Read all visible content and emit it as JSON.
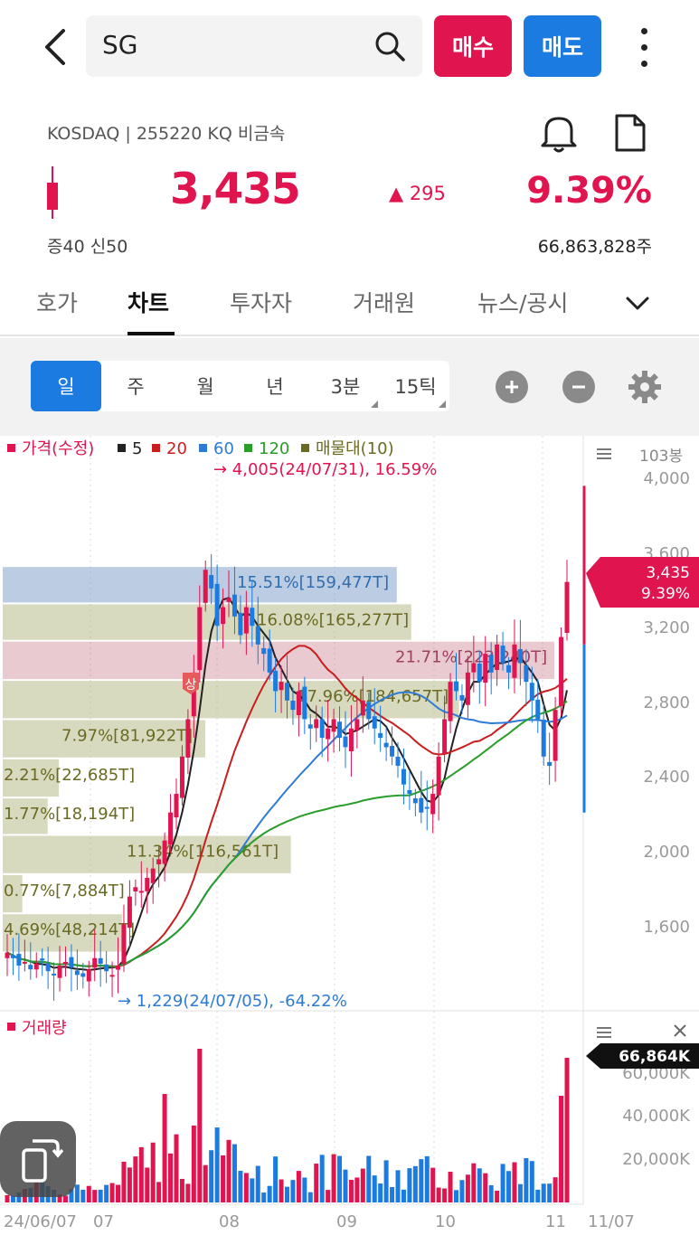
{
  "header": {
    "search_query": "SG",
    "buy_label": "매수",
    "sell_label": "매도"
  },
  "stock": {
    "market_info": "KOSDAQ | 255220 KQ 비금속",
    "price": "3,435",
    "change": "▲ 295",
    "change_pct": "9.39%",
    "margin_info": "증40  신50",
    "volume": "66,863,828주"
  },
  "tabs": [
    {
      "label": "호가"
    },
    {
      "label": "차트"
    },
    {
      "label": "투자자"
    },
    {
      "label": "거래원"
    },
    {
      "label": "뉴스/공시"
    }
  ],
  "periods": [
    {
      "label": "일"
    },
    {
      "label": "주"
    },
    {
      "label": "월"
    },
    {
      "label": "년"
    },
    {
      "label": "3분"
    },
    {
      "label": "15틱"
    }
  ],
  "colors": {
    "up": "#e0144e",
    "down": "#1b7be0",
    "ma5": "#222222",
    "ma20": "#c81e1e",
    "ma60": "#2e7bd6",
    "ma120": "#2a9d2a",
    "profile": "#9aa05a"
  },
  "legend": {
    "price": "가격(수정)",
    "ma5": "5",
    "ma20": "20",
    "ma60": "60",
    "ma120": "120",
    "profile": "매물대(10)"
  },
  "chart_data": [
    {
      "type": "candlestick",
      "unit_label": "103봉",
      "ylim": [
        1229,
        4005
      ],
      "y_ticks": [
        "4,000",
        "3,600",
        "3,200",
        "2,800",
        "2,400",
        "2,000",
        "1,600"
      ],
      "x_ticks": [
        "24/06/07",
        "07",
        "08",
        "09",
        "10",
        "11",
        "11/07"
      ],
      "current_price_badge": {
        "price": "3,435",
        "pct": "9.39%"
      },
      "max_annotation": "→ 4,005(24/07/31), 16.59%",
      "min_annotation": "→ 1,229(24/07/05), -64.22%",
      "volume_profile": [
        {
          "label": "15.51%[159,477T]",
          "price_low": 3320,
          "price_high": 3520,
          "pct": 15.51
        },
        {
          "label": "16.08%[165,277T]",
          "price_low": 3120,
          "price_high": 3320,
          "pct": 16.08
        },
        {
          "label": "21.71%[223,240T]",
          "price_low": 2910,
          "price_high": 3120,
          "pct": 21.71
        },
        {
          "label": "17.96%[184,657T]",
          "price_low": 2700,
          "price_high": 2910,
          "pct": 17.96
        },
        {
          "label": "7.97%[81,922T]",
          "price_low": 2490,
          "price_high": 2700,
          "pct": 7.97
        },
        {
          "label": "2.21%[22,685T]",
          "price_low": 2280,
          "price_high": 2490,
          "pct": 2.21
        },
        {
          "label": "1.77%[18,194T]",
          "price_low": 2080,
          "price_high": 2280,
          "pct": 1.77
        },
        {
          "label": "11.34%[116,561T]",
          "price_low": 1870,
          "price_high": 2080,
          "pct": 11.34
        },
        {
          "label": "0.77%[7,884T]",
          "price_low": 1660,
          "price_high": 1870,
          "pct": 0.77
        },
        {
          "label": "4.69%[48,214T]",
          "price_low": 1450,
          "price_high": 1660,
          "pct": 4.69
        }
      ]
    },
    {
      "type": "bar",
      "title": "거래량",
      "y_ticks": [
        "60,000K",
        "40,000K",
        "20,000K"
      ],
      "current_volume_badge": "66,864K"
    }
  ]
}
